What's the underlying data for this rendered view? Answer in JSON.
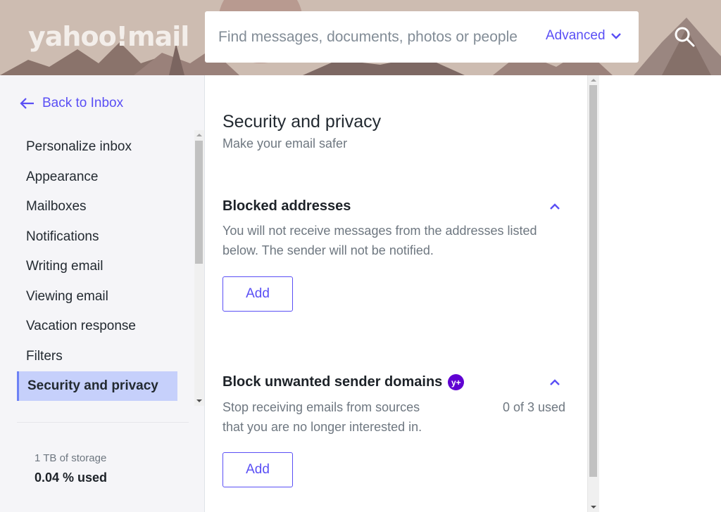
{
  "header": {
    "logo": "yahoo!mail",
    "search_placeholder": "Find messages, documents, photos or people",
    "advanced_label": "Advanced"
  },
  "sidebar": {
    "back_label": "Back to Inbox",
    "items": [
      {
        "label": "Personalize inbox"
      },
      {
        "label": "Appearance"
      },
      {
        "label": "Mailboxes"
      },
      {
        "label": "Notifications"
      },
      {
        "label": "Writing email"
      },
      {
        "label": "Viewing email"
      },
      {
        "label": "Vacation response"
      },
      {
        "label": "Filters"
      },
      {
        "label": "Security and privacy",
        "active": true
      }
    ],
    "storage_label": "1 TB of storage",
    "storage_used": "0.04 % used"
  },
  "main": {
    "title": "Security and privacy",
    "subtitle": "Make your email safer",
    "sections": [
      {
        "title": "Blocked addresses",
        "description_line1": "You will not receive messages from the addresses listed",
        "description_line2": "below. The sender will not be notified.",
        "button": "Add"
      },
      {
        "title": "Block unwanted sender domains",
        "badge": "y+",
        "description_line1": "Stop receiving emails from sources",
        "description_line2": "that you are no longer interested in.",
        "usage": "0 of 3 used",
        "button": "Add"
      }
    ]
  },
  "colors": {
    "accent": "#5a4ff5",
    "active_bg": "#c6d0fb",
    "badge": "#6001d2"
  }
}
